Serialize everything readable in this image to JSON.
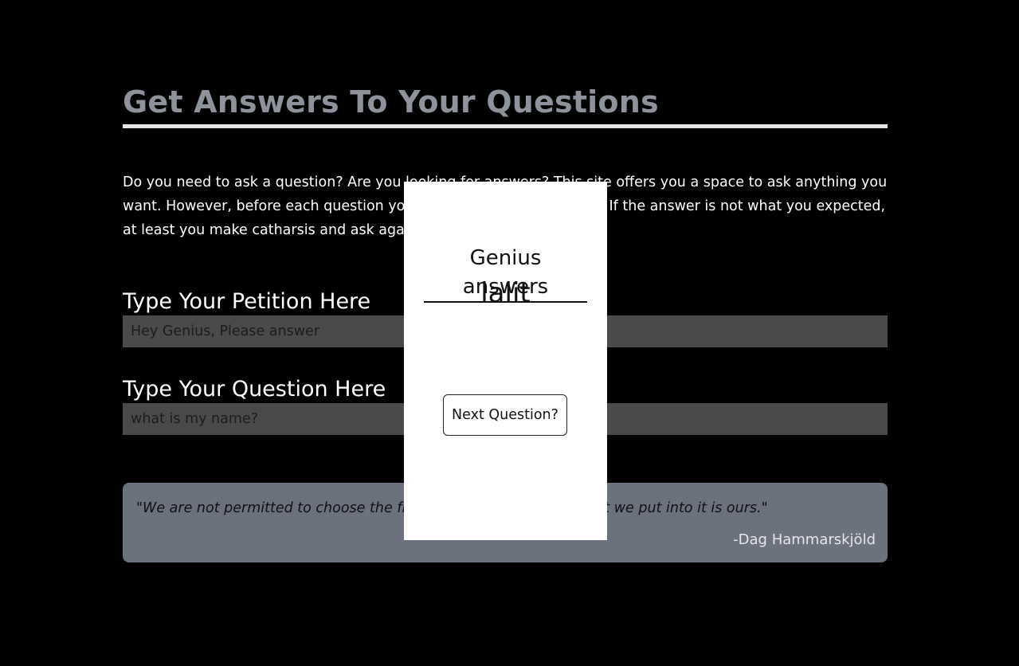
{
  "header": {
    "title": "Get Answers To Your Questions"
  },
  "intro": {
    "text": "Do you need to ask a question? Are you looking for answers? This site offers you a space to ask anything you want. However, before each question you have to type your petition. If the answer is not what you expected, at least you make catharsis and ask again."
  },
  "form": {
    "petition_label": "Type Your Petition Here",
    "petition_value": "Hey Genius, Please answer",
    "question_label": "Type Your Question Here",
    "question_value": "what is my name?"
  },
  "quote": {
    "text": "\"We are not permitted to choose the frame of our destiny. But what we put into it is ours.\"",
    "author": "-Dag Hammarskjöld"
  },
  "modal": {
    "heading": "Genius answers",
    "answer": "lalit",
    "next_label": "Next Question?"
  },
  "colors": {
    "background": "#000000",
    "title": "#8e929b",
    "input_bg": "#4a4a4a",
    "quote_bg": "#6c717e",
    "modal_bg": "#ffffff"
  }
}
